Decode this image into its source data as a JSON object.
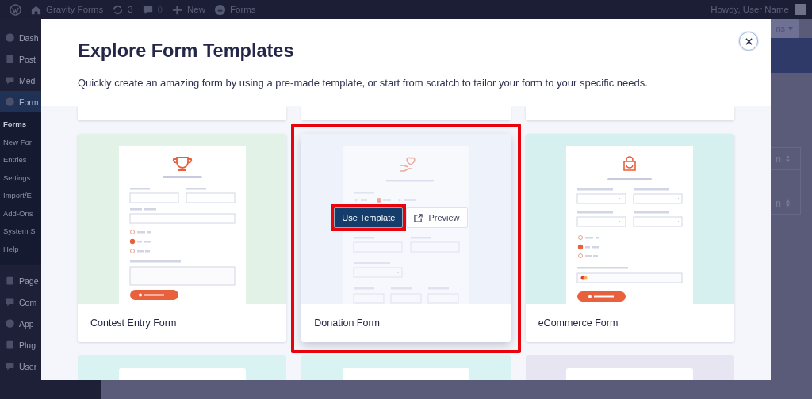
{
  "admin_bar": {
    "site": "Gravity Forms",
    "updates": "3",
    "comments": "0",
    "new": "New",
    "forms": "Forms",
    "greeting": "Howdy, User Name"
  },
  "sidebar": {
    "items": [
      {
        "label": "Dash",
        "selected": false
      },
      {
        "label": "Post",
        "selected": false
      },
      {
        "label": "Med",
        "selected": false
      },
      {
        "label": "Form",
        "selected": true,
        "children": [
          {
            "label": "Forms",
            "selected": true
          },
          {
            "label": "New For",
            "selected": false
          },
          {
            "label": "Entries",
            "selected": false
          },
          {
            "label": "Settings",
            "selected": false
          },
          {
            "label": "Import/E",
            "selected": false
          },
          {
            "label": "Add-Ons",
            "selected": false
          },
          {
            "label": "System S",
            "selected": false
          },
          {
            "label": "Help",
            "selected": false
          }
        ]
      },
      {
        "label": "Page",
        "selected": false
      },
      {
        "label": "Com",
        "selected": false
      },
      {
        "label": "App",
        "selected": false
      },
      {
        "label": "Plug",
        "selected": false
      },
      {
        "label": "User",
        "selected": false
      }
    ]
  },
  "background": {
    "button": "ns",
    "sort_cells": [
      "n",
      "n"
    ]
  },
  "modal": {
    "title": "Explore Form Templates",
    "subtitle": "Quickly create an amazing form by using a pre-made template, or start from scratch to tailor your form to your specific needs.",
    "actions": {
      "use": "Use Template",
      "preview": "Preview"
    },
    "templates": [
      {
        "name": "Contest Entry Form",
        "kind": "contest",
        "color": "#e3f2e6",
        "selected": false
      },
      {
        "name": "Donation Form",
        "kind": "donation",
        "color": "#eef2fb",
        "selected": true
      },
      {
        "name": "eCommerce Form",
        "kind": "ecommerce",
        "color": "#d6f0f0",
        "selected": false
      }
    ],
    "next_row": [
      {
        "color": "#d9f2f2"
      },
      {
        "color": "#d9f2f2"
      },
      {
        "color": "#e8e5f3"
      }
    ]
  }
}
